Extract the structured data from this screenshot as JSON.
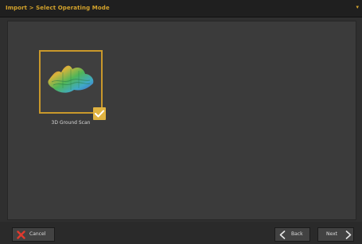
{
  "window": {
    "title": "Import > Select Operating Mode",
    "title_marker": "▾"
  },
  "modes": [
    {
      "label": "3D Ground Scan",
      "icon": "3d-terrain-icon",
      "selected": true
    }
  ],
  "footer": {
    "cancel_label": "Cancel",
    "back_label": "Back",
    "next_label": "Next"
  },
  "colors": {
    "accent": "#d4a32c",
    "cancel_icon": "#e03a2e"
  }
}
